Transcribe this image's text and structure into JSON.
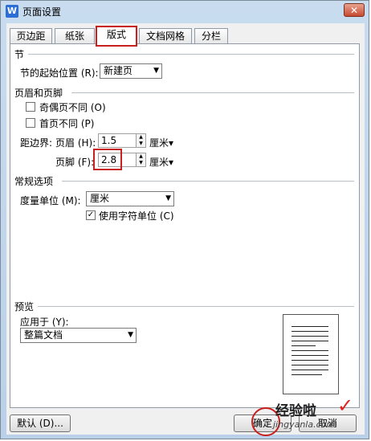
{
  "window": {
    "title": "页面设置",
    "close": "✕"
  },
  "tabs": [
    "页边距",
    "纸张",
    "版式",
    "文档网格",
    "分栏"
  ],
  "section": {
    "title": "节",
    "start_label": "节的起始位置 (R):",
    "start_value": "新建页"
  },
  "header_footer": {
    "title": "页眉和页脚",
    "odd_even_label": "奇偶页不同 (O)",
    "first_page_label": "首页不同 (P)",
    "from_edge_label": "距边界:",
    "header_label": "页眉 (H):",
    "header_value": "1.5",
    "footer_label": "页脚 (F):",
    "footer_value": "2.8",
    "unit": "厘米▾"
  },
  "general": {
    "title": "常规选项",
    "measure_label": "度量单位 (M):",
    "measure_value": "厘米",
    "char_units_label": "使用字符单位 (C)",
    "char_units_checked": "✓"
  },
  "preview": {
    "title": "预览",
    "apply_label": "应用于 (Y):",
    "apply_value": "整篇文档"
  },
  "buttons": {
    "default": "默认 (D)...",
    "ok": "确定",
    "cancel": "取消"
  },
  "watermark": {
    "text": "经验啦",
    "check": "✓",
    "url": "jingyanla.com"
  }
}
